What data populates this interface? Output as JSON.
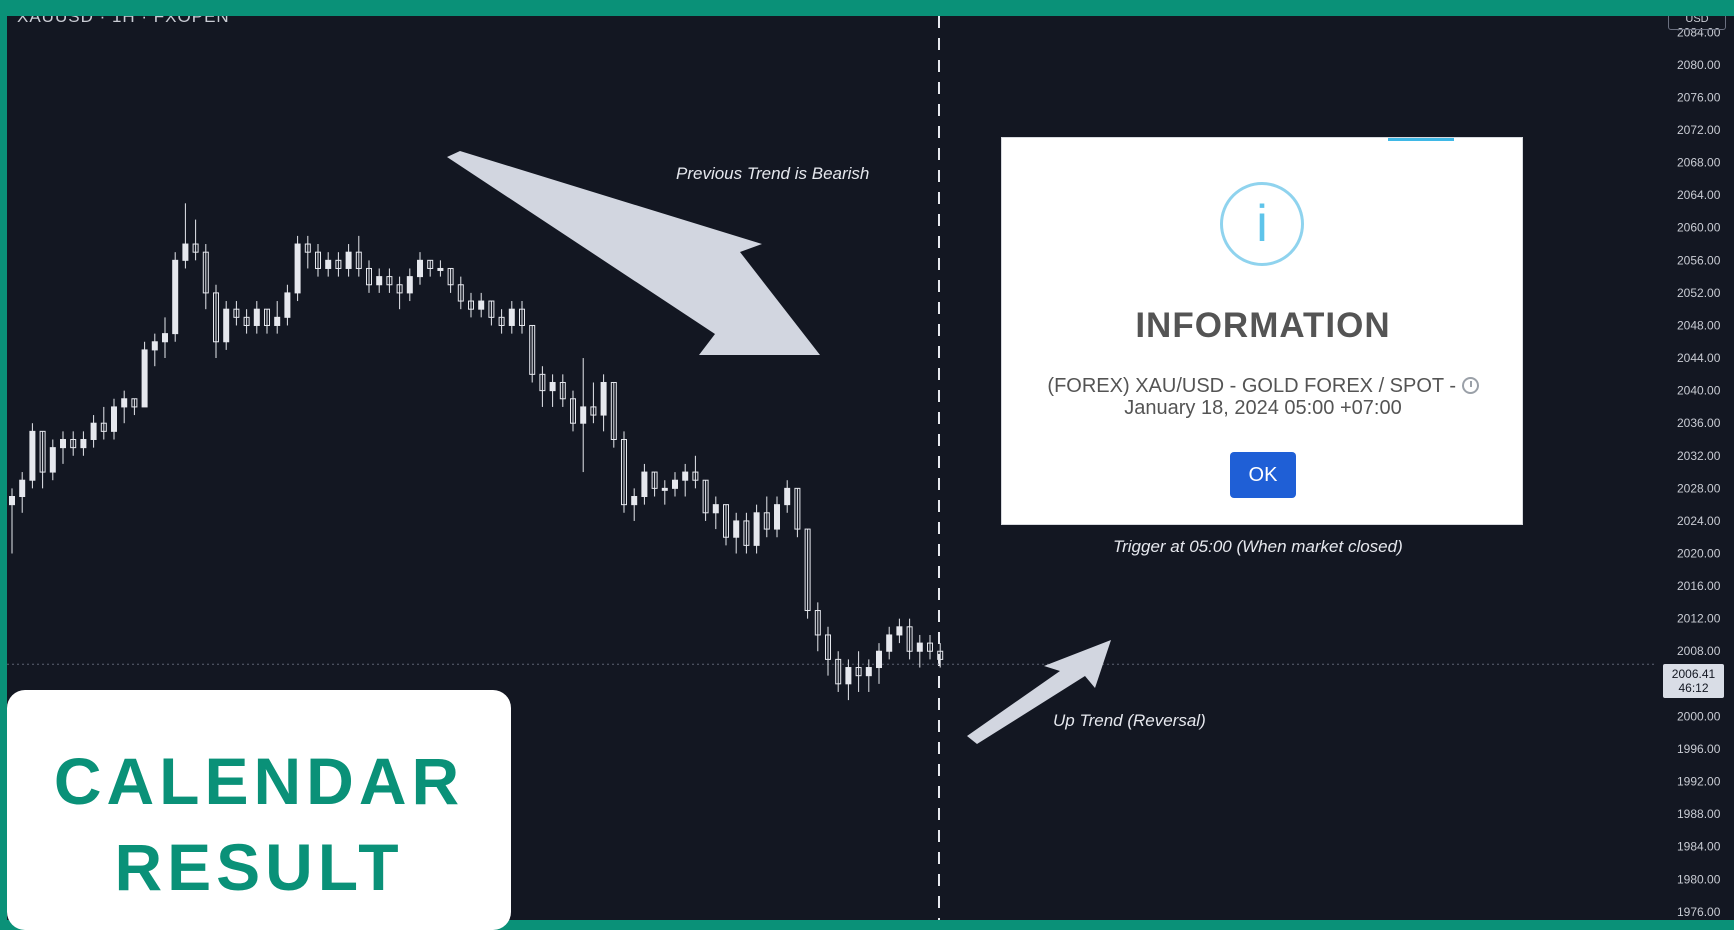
{
  "chart": {
    "symbol": "XAUUSD · 1H · FXOPEN",
    "axis_unit": "USD",
    "price_ticks": [
      "2084.00",
      "2080.00",
      "2076.00",
      "2072.00",
      "2068.00",
      "2064.00",
      "2060.00",
      "2056.00",
      "2052.00",
      "2048.00",
      "2044.00",
      "2040.00",
      "2036.00",
      "2032.00",
      "2028.00",
      "2024.00",
      "2020.00",
      "2016.00",
      "2012.00",
      "2008.00",
      "2000.00",
      "1996.00",
      "1992.00",
      "1988.00",
      "1984.00",
      "1980.00",
      "1976.00"
    ],
    "current_price": "2006.41",
    "countdown": "46:12",
    "annotations": {
      "previous_trend": "Previous Trend is Bearish",
      "trigger": "Trigger at 05:00 (When market closed)",
      "up_trend": "Up Trend (Reversal)"
    },
    "colors": {
      "background": "#131722",
      "candle": "#e6e8ee",
      "arrow": "#d2d6e0"
    }
  },
  "chart_data": {
    "type": "candlestick",
    "ylim": [
      1975,
      2086
    ],
    "candles": [
      [
        2026,
        2028,
        2020,
        2027
      ],
      [
        2027,
        2030,
        2025,
        2029
      ],
      [
        2029,
        2036,
        2028,
        2035
      ],
      [
        2035,
        2035,
        2028,
        2030
      ],
      [
        2030,
        2034,
        2029,
        2033
      ],
      [
        2033,
        2035,
        2031,
        2034
      ],
      [
        2034,
        2035,
        2032,
        2033
      ],
      [
        2033,
        2035,
        2032,
        2034
      ],
      [
        2034,
        2037,
        2033,
        2036
      ],
      [
        2036,
        2038,
        2034,
        2035
      ],
      [
        2035,
        2039,
        2034,
        2038
      ],
      [
        2038,
        2040,
        2036,
        2039
      ],
      [
        2039,
        2039,
        2037,
        2038
      ],
      [
        2038,
        2046,
        2038,
        2045
      ],
      [
        2045,
        2047,
        2043,
        2046
      ],
      [
        2046,
        2049,
        2044,
        2047
      ],
      [
        2047,
        2057,
        2046,
        2056
      ],
      [
        2056,
        2063,
        2055,
        2058
      ],
      [
        2058,
        2061,
        2056,
        2057
      ],
      [
        2057,
        2058,
        2050,
        2052
      ],
      [
        2052,
        2053,
        2044,
        2046
      ],
      [
        2046,
        2051,
        2045,
        2050
      ],
      [
        2050,
        2051,
        2048,
        2049
      ],
      [
        2049,
        2050,
        2047,
        2048
      ],
      [
        2048,
        2051,
        2047,
        2050
      ],
      [
        2050,
        2050,
        2047,
        2048
      ],
      [
        2048,
        2051,
        2047,
        2049
      ],
      [
        2049,
        2053,
        2048,
        2052
      ],
      [
        2052,
        2059,
        2051,
        2058
      ],
      [
        2058,
        2059,
        2055,
        2057
      ],
      [
        2057,
        2058,
        2054,
        2055
      ],
      [
        2055,
        2057,
        2054,
        2056
      ],
      [
        2056,
        2057,
        2054,
        2055
      ],
      [
        2055,
        2058,
        2054,
        2057
      ],
      [
        2057,
        2059,
        2054,
        2055
      ],
      [
        2055,
        2056,
        2052,
        2053
      ],
      [
        2053,
        2055,
        2052,
        2054
      ],
      [
        2054,
        2055,
        2052,
        2053
      ],
      [
        2053,
        2054,
        2050,
        2052
      ],
      [
        2052,
        2055,
        2051,
        2054
      ],
      [
        2054,
        2057,
        2053,
        2056
      ],
      [
        2056,
        2056,
        2054,
        2055
      ],
      [
        2055,
        2056,
        2054,
        2055
      ],
      [
        2055,
        2055,
        2052,
        2053
      ],
      [
        2053,
        2054,
        2050,
        2051
      ],
      [
        2051,
        2052,
        2049,
        2050
      ],
      [
        2050,
        2052,
        2049,
        2051
      ],
      [
        2051,
        2051,
        2048,
        2049
      ],
      [
        2049,
        2050,
        2047,
        2048
      ],
      [
        2048,
        2051,
        2047,
        2050
      ],
      [
        2050,
        2051,
        2047,
        2048
      ],
      [
        2048,
        2048,
        2041,
        2042
      ],
      [
        2042,
        2043,
        2038,
        2040
      ],
      [
        2040,
        2042,
        2038,
        2041
      ],
      [
        2041,
        2042,
        2038,
        2039
      ],
      [
        2039,
        2040,
        2035,
        2036
      ],
      [
        2036,
        2044,
        2030,
        2038
      ],
      [
        2038,
        2041,
        2036,
        2037
      ],
      [
        2037,
        2042,
        2035,
        2041
      ],
      [
        2041,
        2041,
        2033,
        2034
      ],
      [
        2034,
        2035,
        2025,
        2026
      ],
      [
        2026,
        2028,
        2024,
        2027
      ],
      [
        2027,
        2031,
        2026,
        2030
      ],
      [
        2030,
        2030,
        2027,
        2028
      ],
      [
        2028,
        2029,
        2026,
        2028
      ],
      [
        2028,
        2030,
        2027,
        2029
      ],
      [
        2029,
        2031,
        2027,
        2030
      ],
      [
        2030,
        2032,
        2028,
        2029
      ],
      [
        2029,
        2029,
        2024,
        2025
      ],
      [
        2025,
        2027,
        2023,
        2026
      ],
      [
        2026,
        2026,
        2021,
        2022
      ],
      [
        2022,
        2025,
        2020,
        2024
      ],
      [
        2024,
        2025,
        2020,
        2021
      ],
      [
        2021,
        2026,
        2020,
        2025
      ],
      [
        2025,
        2027,
        2022,
        2023
      ],
      [
        2023,
        2027,
        2022,
        2026
      ],
      [
        2026,
        2029,
        2025,
        2028
      ],
      [
        2028,
        2028,
        2022,
        2023
      ],
      [
        2023,
        2023,
        2012,
        2013
      ],
      [
        2013,
        2014,
        2008,
        2010
      ],
      [
        2010,
        2011,
        2005,
        2007
      ],
      [
        2007,
        2008,
        2003,
        2004
      ],
      [
        2004,
        2007,
        2002,
        2006
      ],
      [
        2006,
        2008,
        2003,
        2005
      ],
      [
        2005,
        2007,
        2003,
        2006
      ],
      [
        2006,
        2009,
        2004,
        2008
      ],
      [
        2008,
        2011,
        2007,
        2010
      ],
      [
        2010,
        2012,
        2009,
        2011
      ],
      [
        2011,
        2012,
        2007,
        2008
      ],
      [
        2008,
        2010,
        2006,
        2009
      ],
      [
        2009,
        2010,
        2007,
        2008
      ],
      [
        2008,
        2009,
        2006,
        2007
      ]
    ]
  },
  "modal": {
    "title": "INFORMATION",
    "message_line1": "(FOREX) XAU/USD - GOLD FOREX / SPOT -",
    "message_line2": "January 18, 2024 05:00 +07:00",
    "ok_label": "OK",
    "info_glyph": "i",
    "icon": "info-circle-icon",
    "clock_icon": "clock-icon"
  },
  "card": {
    "line1": "CALENDAR",
    "line2": "RESULT",
    "accent": "#0a9178"
  }
}
